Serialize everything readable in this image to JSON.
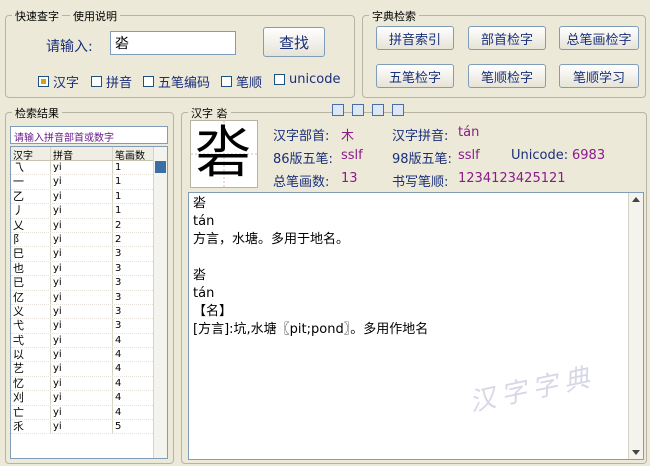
{
  "quick": {
    "title": "快速查字",
    "help": "使用说明",
    "input_label": "请输入:",
    "input_value": "沯",
    "search_btn": "查找",
    "options": [
      {
        "label": "汉字",
        "checked": true
      },
      {
        "label": "拼音",
        "checked": false
      },
      {
        "label": "五笔编码",
        "checked": false
      },
      {
        "label": "笔顺",
        "checked": false
      },
      {
        "label": "unicode",
        "checked": false
      }
    ]
  },
  "dict": {
    "title": "字典检索",
    "buttons": [
      "拼音索引",
      "部首检字",
      "总笔画检字",
      "五笔检字",
      "笔顺检字",
      "笔顺学习"
    ]
  },
  "results": {
    "title": "检索结果",
    "hint": "请输入拼音部首或数字",
    "columns": [
      "汉字",
      "拼音",
      "笔画数"
    ],
    "rows": [
      [
        "乁",
        "yi",
        "1"
      ],
      [
        "一",
        "yi",
        "1"
      ],
      [
        "乙",
        "yi",
        "1"
      ],
      [
        "丿",
        "yi",
        "1"
      ],
      [
        "乂",
        "yi",
        "2"
      ],
      [
        "阝",
        "yi",
        "2"
      ],
      [
        "巳",
        "yi",
        "3"
      ],
      [
        "也",
        "yi",
        "3"
      ],
      [
        "已",
        "yi",
        "3"
      ],
      [
        "亿",
        "yi",
        "3"
      ],
      [
        "义",
        "yi",
        "3"
      ],
      [
        "弋",
        "yi",
        "3"
      ],
      [
        "弌",
        "yi",
        "4"
      ],
      [
        "以",
        "yi",
        "4"
      ],
      [
        "艺",
        "yi",
        "4"
      ],
      [
        "忆",
        "yi",
        "4"
      ],
      [
        "刈",
        "yi",
        "4"
      ],
      [
        "亡",
        "yi",
        "4"
      ],
      [
        "乑",
        "yi",
        "5"
      ]
    ]
  },
  "detail": {
    "title": "汉字 沯",
    "char": "沯",
    "bushou_label": "汉字部首:",
    "bushou": "木",
    "pinyin_label": "汉字拼音:",
    "pinyin": "tán",
    "wubi86_label": "86版五笔:",
    "wubi86": "sslf",
    "wubi98_label": "98版五笔:",
    "wubi98": "sslf",
    "unicode_label": "Unicode:",
    "unicode": "6983",
    "strokes_label": "总笔画数:",
    "strokes": "13",
    "order_label": "书写笔顺:",
    "order": "1234123425121",
    "text_lines": [
      "沯",
      "tán",
      "方言，水塘。多用于地名。",
      "",
      "沯",
      "tán",
      "【名】",
      "[方言]:坑,水塘〖pit;pond〗。多用作地名"
    ]
  },
  "watermark": "汉字字典"
}
